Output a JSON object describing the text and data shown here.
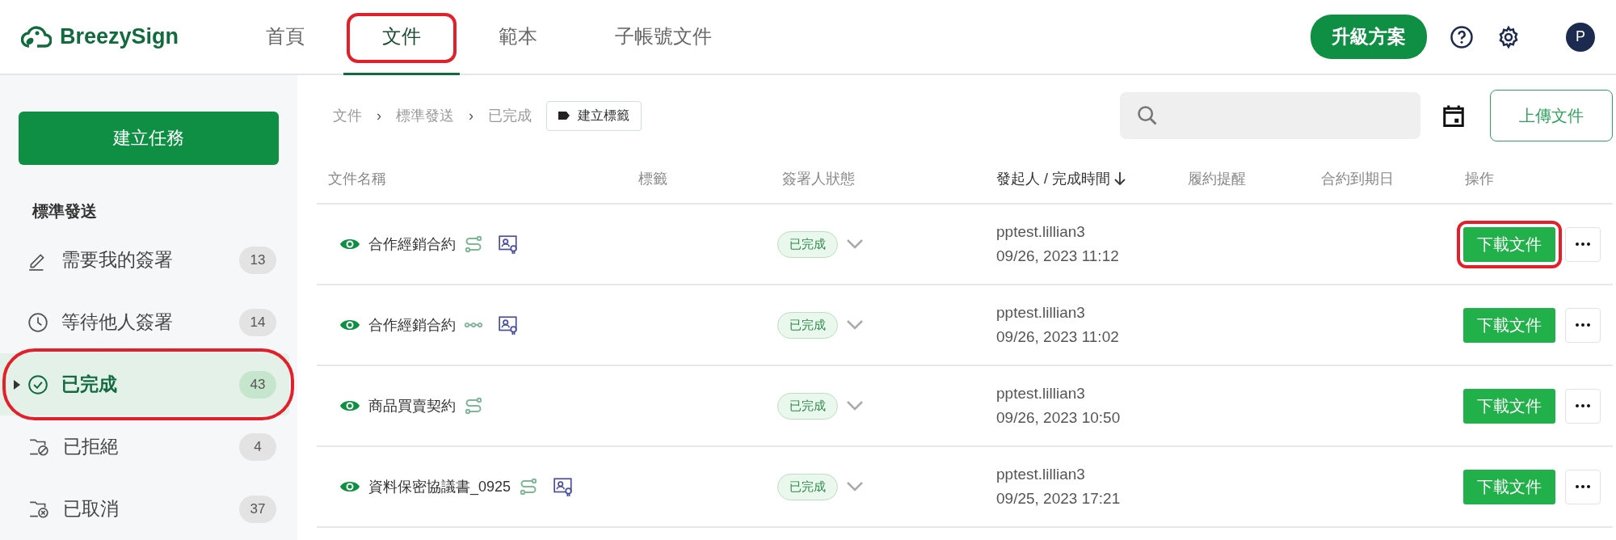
{
  "brand": {
    "name": "BreezySign"
  },
  "nav": {
    "tabs": [
      {
        "label": "首頁",
        "selected": false,
        "highlighted": false
      },
      {
        "label": "文件",
        "selected": true,
        "highlighted": true
      },
      {
        "label": "範本",
        "selected": false,
        "highlighted": false
      },
      {
        "label": "子帳號文件",
        "selected": false,
        "highlighted": false
      }
    ],
    "upgrade_button": "升級方案",
    "avatar": "P"
  },
  "sidebar": {
    "create_button": "建立任務",
    "section_title": "標準發送",
    "items": [
      {
        "kind": "pen",
        "label": "需要我的簽署",
        "count": "13",
        "selected": false,
        "highlighted": false
      },
      {
        "kind": "clock",
        "label": "等待他人簽署",
        "count": "14",
        "selected": false,
        "highlighted": false
      },
      {
        "kind": "check",
        "label": "已完成",
        "count": "43",
        "selected": true,
        "highlighted": true
      },
      {
        "kind": "rejected",
        "label": "已拒絕",
        "count": "4",
        "selected": false,
        "highlighted": false
      },
      {
        "kind": "cancelled",
        "label": "已取消",
        "count": "37",
        "selected": false,
        "highlighted": false
      }
    ]
  },
  "breadcrumb": {
    "items": [
      "文件",
      "標準發送",
      "已完成"
    ],
    "separators": [
      "›",
      "›"
    ]
  },
  "tag_button": "建立標籤",
  "upload_button": "上傳文件",
  "table": {
    "columns": [
      {
        "label": "文件名稱",
        "sorted": false
      },
      {
        "label": "標籤",
        "sorted": false
      },
      {
        "label": "簽署人狀態",
        "sorted": false
      },
      {
        "label": "發起人 / 完成時間",
        "sorted": true
      },
      {
        "label": "履約提醒",
        "sorted": false
      },
      {
        "label": "合約到期日",
        "sorted": false
      },
      {
        "label": "操作",
        "sorted": false
      }
    ],
    "rows": [
      {
        "name": "合作經銷合約",
        "kind": "sequential",
        "certificate": true,
        "status": "已完成",
        "initiator": "pptest.lillian3",
        "time": "09/26, 2023 11:12",
        "action": "下載文件",
        "highlighted": true
      },
      {
        "name": "合作經銷合約",
        "kind": "parallel",
        "certificate": true,
        "status": "已完成",
        "initiator": "pptest.lillian3",
        "time": "09/26, 2023 11:02",
        "action": "下載文件",
        "highlighted": false
      },
      {
        "name": "商品買賣契約",
        "kind": "sequential",
        "certificate": false,
        "status": "已完成",
        "initiator": "pptest.lillian3",
        "time": "09/26, 2023 10:50",
        "action": "下載文件",
        "highlighted": false
      },
      {
        "name": "資料保密協議書_0925",
        "kind": "sequential",
        "certificate": true,
        "status": "已完成",
        "initiator": "pptest.lillian3",
        "time": "09/25, 2023 17:21",
        "action": "下載文件",
        "highlighted": false
      }
    ]
  }
}
